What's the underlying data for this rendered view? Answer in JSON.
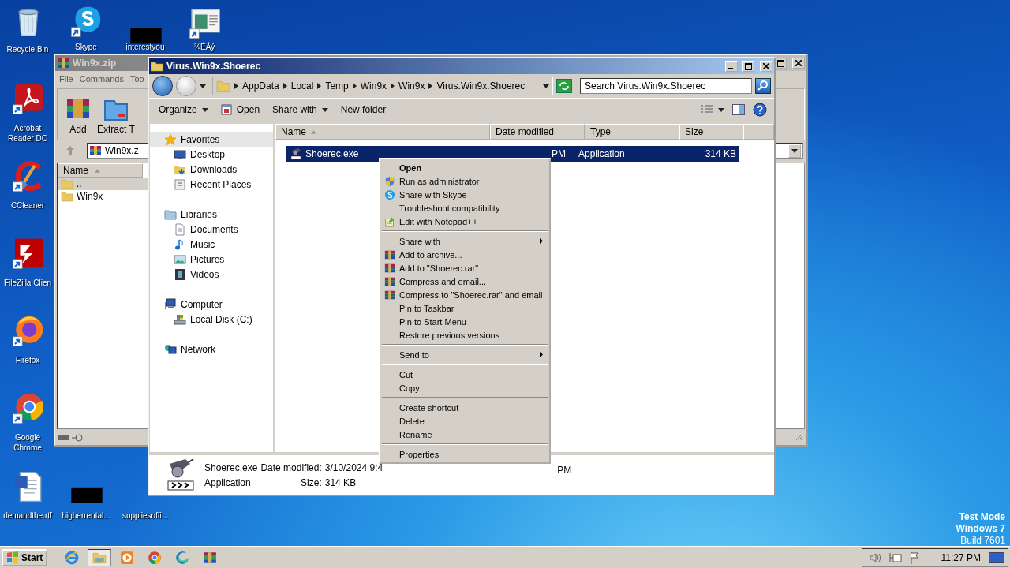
{
  "desktop": {
    "icons": [
      {
        "label": "Recycle Bin",
        "kind": "recycle"
      },
      {
        "label": "Skype",
        "kind": "skype"
      },
      {
        "label": "interestyou",
        "kind": "blank"
      },
      {
        "label": "¾ÉÁý",
        "kind": "window"
      },
      {
        "label": "Acrobat Reader DC",
        "kind": "acrobat"
      },
      {
        "label": "CCleaner",
        "kind": "ccleaner"
      },
      {
        "label": "FileZilla Clien",
        "kind": "filezilla"
      },
      {
        "label": "Firefox",
        "kind": "firefox"
      },
      {
        "label": "Google Chrome",
        "kind": "chrome"
      },
      {
        "label": "demandthe.rtf",
        "kind": "word"
      },
      {
        "label": "higherrental...",
        "kind": "blank"
      },
      {
        "label": "suppliesoffi...",
        "kind": "hidden"
      }
    ],
    "notice": [
      {
        "text": "Test Mode",
        "bold": true
      },
      {
        "text": "Windows 7",
        "bold": true
      },
      {
        "text": "Build 7601",
        "bold": false
      }
    ]
  },
  "archive_window": {
    "title": "Win9x.zip",
    "menu": [
      "File",
      "Commands",
      "Too"
    ],
    "toolbar": [
      {
        "label": "Add",
        "kind": "add"
      },
      {
        "label": "Extract T",
        "kind": "extract"
      }
    ],
    "path": "Win9x.z",
    "column": "Name",
    "rows": [
      {
        "name": "..",
        "selected": true
      },
      {
        "name": "Win9x",
        "selected": false
      }
    ]
  },
  "explorer": {
    "title": "Virus.Win9x.Shoerec",
    "breadcrumbs": [
      "AppData",
      "Local",
      "Temp",
      "Win9x",
      "Win9x",
      "Virus.Win9x.Shoerec"
    ],
    "search": {
      "placeholder": "Search Virus.Win9x.Shoerec"
    },
    "toolbar": [
      {
        "label": "Organize",
        "kind": "menu"
      },
      {
        "label": "Open",
        "kind": "icon"
      },
      {
        "label": "Share with",
        "kind": "menu"
      },
      {
        "label": "New folder",
        "kind": "plain"
      }
    ],
    "nav": [
      {
        "label": "Favorites",
        "kind": "star",
        "selected": true,
        "children": [
          {
            "label": "Desktop",
            "kind": "desktop",
            "selected": false
          },
          {
            "label": "Downloads",
            "kind": "downloads",
            "selected": false
          },
          {
            "label": "Recent Places",
            "kind": "recent",
            "selected": false
          }
        ]
      },
      {
        "label": "Libraries",
        "kind": "libraries",
        "selected": false,
        "children": [
          {
            "label": "Documents",
            "kind": "documents",
            "selected": false
          },
          {
            "label": "Music",
            "kind": "music",
            "selected": false
          },
          {
            "label": "Pictures",
            "kind": "pictures",
            "selected": false
          },
          {
            "label": "Videos",
            "kind": "videos",
            "selected": false
          }
        ]
      },
      {
        "label": "Computer",
        "kind": "computer",
        "selected": false,
        "children": [
          {
            "label": "Local Disk (C:)",
            "kind": "disk",
            "selected": false
          }
        ]
      },
      {
        "label": "Network",
        "kind": "network",
        "selected": false
      }
    ],
    "columns": [
      "Name",
      "Date modified",
      "Type",
      "Size"
    ],
    "files": [
      {
        "name": "Shoerec.exe",
        "date_modified": "PM",
        "type": "Application",
        "size": "314 KB",
        "selected": true
      }
    ],
    "details": {
      "name": "Shoerec.exe",
      "date_modified_label": "Date modified:",
      "date_modified": "3/10/2024 9:4",
      "date_created": "PM",
      "type": "Application",
      "size_label": "Size:",
      "size": "314 KB"
    }
  },
  "context_menu": {
    "groups": [
      [
        {
          "label": "Open",
          "kind": "default"
        },
        {
          "label": "Run as administrator",
          "kind": "shield"
        },
        {
          "label": "Share with Skype",
          "kind": "skype"
        },
        {
          "label": "Troubleshoot compatibility",
          "kind": "plain"
        },
        {
          "label": "Edit with Notepad++",
          "kind": "notepad"
        }
      ],
      [
        {
          "label": "Share with",
          "kind": "submenu"
        },
        {
          "label": "Add to archive...",
          "kind": "archive"
        },
        {
          "label": "Add to \"Shoerec.rar\"",
          "kind": "archive"
        },
        {
          "label": "Compress and email...",
          "kind": "archive"
        },
        {
          "label": "Compress to \"Shoerec.rar\" and email",
          "kind": "archive"
        },
        {
          "label": "Pin to Taskbar",
          "kind": "plain"
        },
        {
          "label": "Pin to Start Menu",
          "kind": "plain"
        },
        {
          "label": "Restore previous versions",
          "kind": "plain"
        }
      ],
      [
        {
          "label": "Send to",
          "kind": "submenu"
        }
      ],
      [
        {
          "label": "Cut",
          "kind": "plain"
        },
        {
          "label": "Copy",
          "kind": "plain"
        }
      ],
      [
        {
          "label": "Create shortcut",
          "kind": "plain"
        },
        {
          "label": "Delete",
          "kind": "plain"
        },
        {
          "label": "Rename",
          "kind": "plain"
        }
      ],
      [
        {
          "label": "Properties",
          "kind": "plain"
        }
      ]
    ]
  },
  "taskbar": {
    "start": "Start",
    "apps": [
      {
        "kind": "ie",
        "selected": false
      },
      {
        "kind": "explorer",
        "selected": true
      },
      {
        "kind": "media",
        "selected": false
      },
      {
        "kind": "chrome",
        "selected": false
      },
      {
        "kind": "edge",
        "selected": false
      },
      {
        "kind": "winrar",
        "selected": false
      }
    ],
    "clock": "11:27 PM"
  }
}
